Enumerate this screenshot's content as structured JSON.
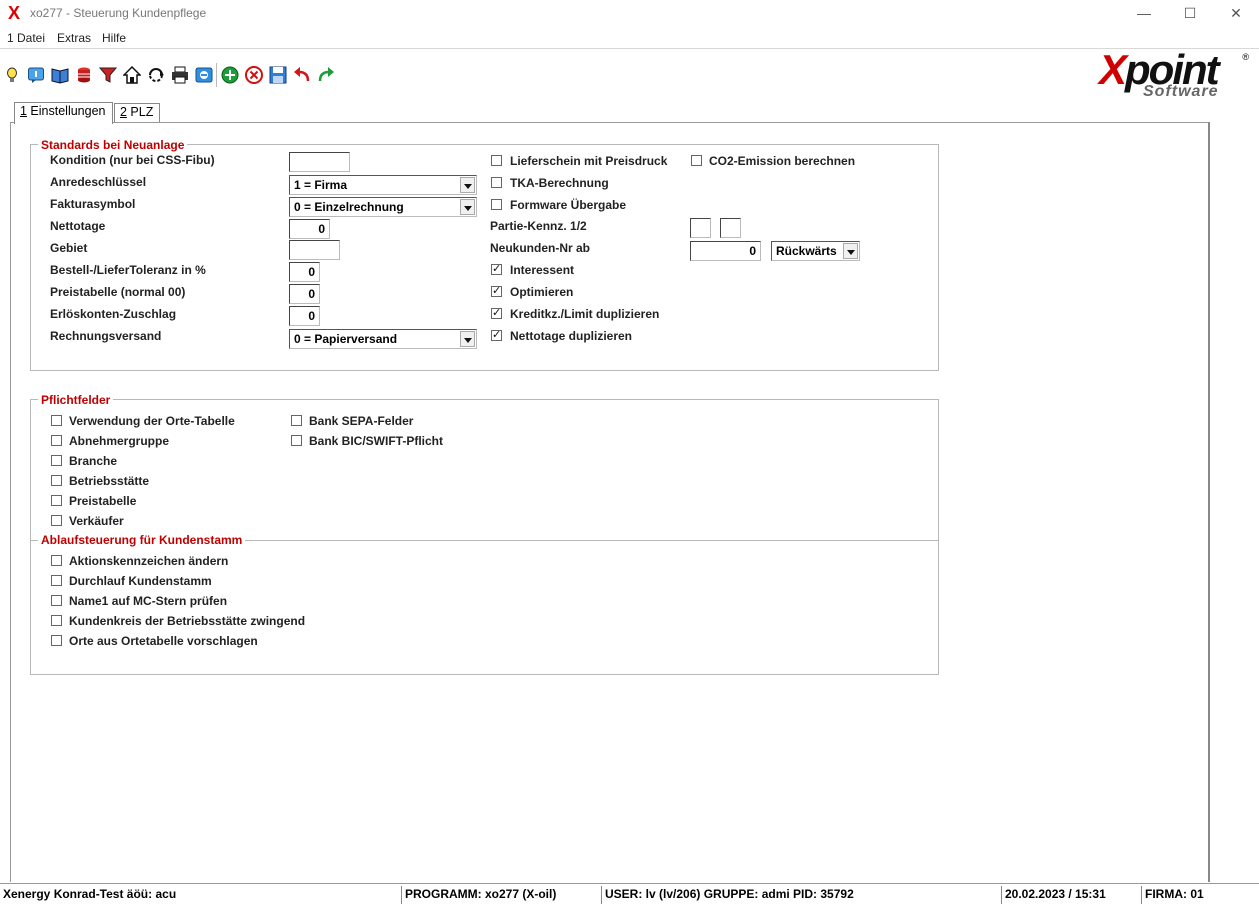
{
  "window": {
    "title": "xo277 - Steuerung Kundenpflege",
    "app_icon": "X",
    "controls": [
      "minimize",
      "maximize",
      "close"
    ]
  },
  "menu": [
    "1 Datei",
    "Extras",
    "Hilfe"
  ],
  "toolbar_icons": [
    "lightbulb-icon",
    "info-icon",
    "book-icon",
    "database-icon",
    "filter-icon",
    "home-icon",
    "refresh-icon",
    "print-icon",
    "export-icon",
    "add-icon",
    "delete-icon",
    "save-icon",
    "undo-icon",
    "redo-icon"
  ],
  "logo": {
    "main": "Xpoint",
    "x": "X",
    "rest": "point",
    "sub": "Software",
    "reg": "®"
  },
  "tabs": [
    {
      "key": "1",
      "label": " Einstellungen",
      "active": true
    },
    {
      "key": "2",
      "label": " PLZ",
      "active": false
    }
  ],
  "standards": {
    "legend": "Standards bei Neuanlage",
    "kondition": {
      "label": "Kondition (nur bei CSS-Fibu)",
      "value": ""
    },
    "anrede": {
      "label": "Anredeschlüssel",
      "value": "1 = Firma"
    },
    "faktura": {
      "label": "Fakturasymbol",
      "value": "0 = Einzelrechnung"
    },
    "nettotage": {
      "label": "Nettotage",
      "value": "0"
    },
    "gebiet": {
      "label": "Gebiet",
      "value": ""
    },
    "toleranz": {
      "label": "Bestell-/LieferToleranz in %",
      "value": "0"
    },
    "preistabelle": {
      "label": "Preistabelle (normal 00)",
      "value": "0"
    },
    "erloeskonten": {
      "label": "Erlöskonten-Zuschlag",
      "value": "0"
    },
    "rechnungsversand": {
      "label": "Rechnungsversand",
      "value": "0 = Papierversand"
    },
    "lieferschein": {
      "label": "Lieferschein mit Preisdruck",
      "checked": false
    },
    "co2": {
      "label": "CO2-Emission berechnen",
      "checked": false
    },
    "tka": {
      "label": "TKA-Berechnung",
      "checked": false
    },
    "formware": {
      "label": "Formware Übergabe",
      "checked": false
    },
    "partie": {
      "label": "Partie-Kennz. 1/2",
      "value1": "",
      "value2": ""
    },
    "neukunden": {
      "label": "Neukunden-Nr ab",
      "value": "0",
      "direction": "Rückwärts"
    },
    "interessent": {
      "label": "Interessent",
      "checked": true
    },
    "optimieren": {
      "label": "Optimieren",
      "checked": true
    },
    "kreditkz": {
      "label": "Kreditkz./Limit duplizieren",
      "checked": true
    },
    "nettotage_dup": {
      "label": "Nettotage duplizieren",
      "checked": true
    }
  },
  "pflichtfelder": {
    "legend": "Pflichtfelder",
    "left": [
      {
        "label": "Verwendung der Orte-Tabelle",
        "checked": false
      },
      {
        "label": "Abnehmergruppe",
        "checked": false
      },
      {
        "label": "Branche",
        "checked": false
      },
      {
        "label": "Betriebsstätte",
        "checked": false
      },
      {
        "label": "Preistabelle",
        "checked": false
      },
      {
        "label": "Verkäufer",
        "checked": false
      }
    ],
    "right": [
      {
        "label": "Bank SEPA-Felder",
        "checked": false
      },
      {
        "label": "Bank BIC/SWIFT-Pflicht",
        "checked": false
      }
    ]
  },
  "ablauf": {
    "legend": "Ablaufsteuerung für Kundenstamm",
    "items": [
      {
        "label": "Aktionskennzeichen ändern",
        "checked": false
      },
      {
        "label": "Durchlauf Kundenstamm",
        "checked": false
      },
      {
        "label": "Name1 auf MC-Stern prüfen",
        "checked": false
      },
      {
        "label": "Kundenkreis der Betriebsstätte zwingend",
        "checked": false
      },
      {
        "label": "Orte aus Ortetabelle vorschlagen",
        "checked": false
      }
    ]
  },
  "status": {
    "mandant": "Xenergy Konrad-Test äöü: acu",
    "programm": "PROGRAMM: xo277 (X-oil)",
    "user": "USER: lv (lv/206)  GRUPPE: admi  PID: 35792",
    "datetime": "20.02.2023 / 15:31",
    "firma": "FIRMA: 01"
  }
}
